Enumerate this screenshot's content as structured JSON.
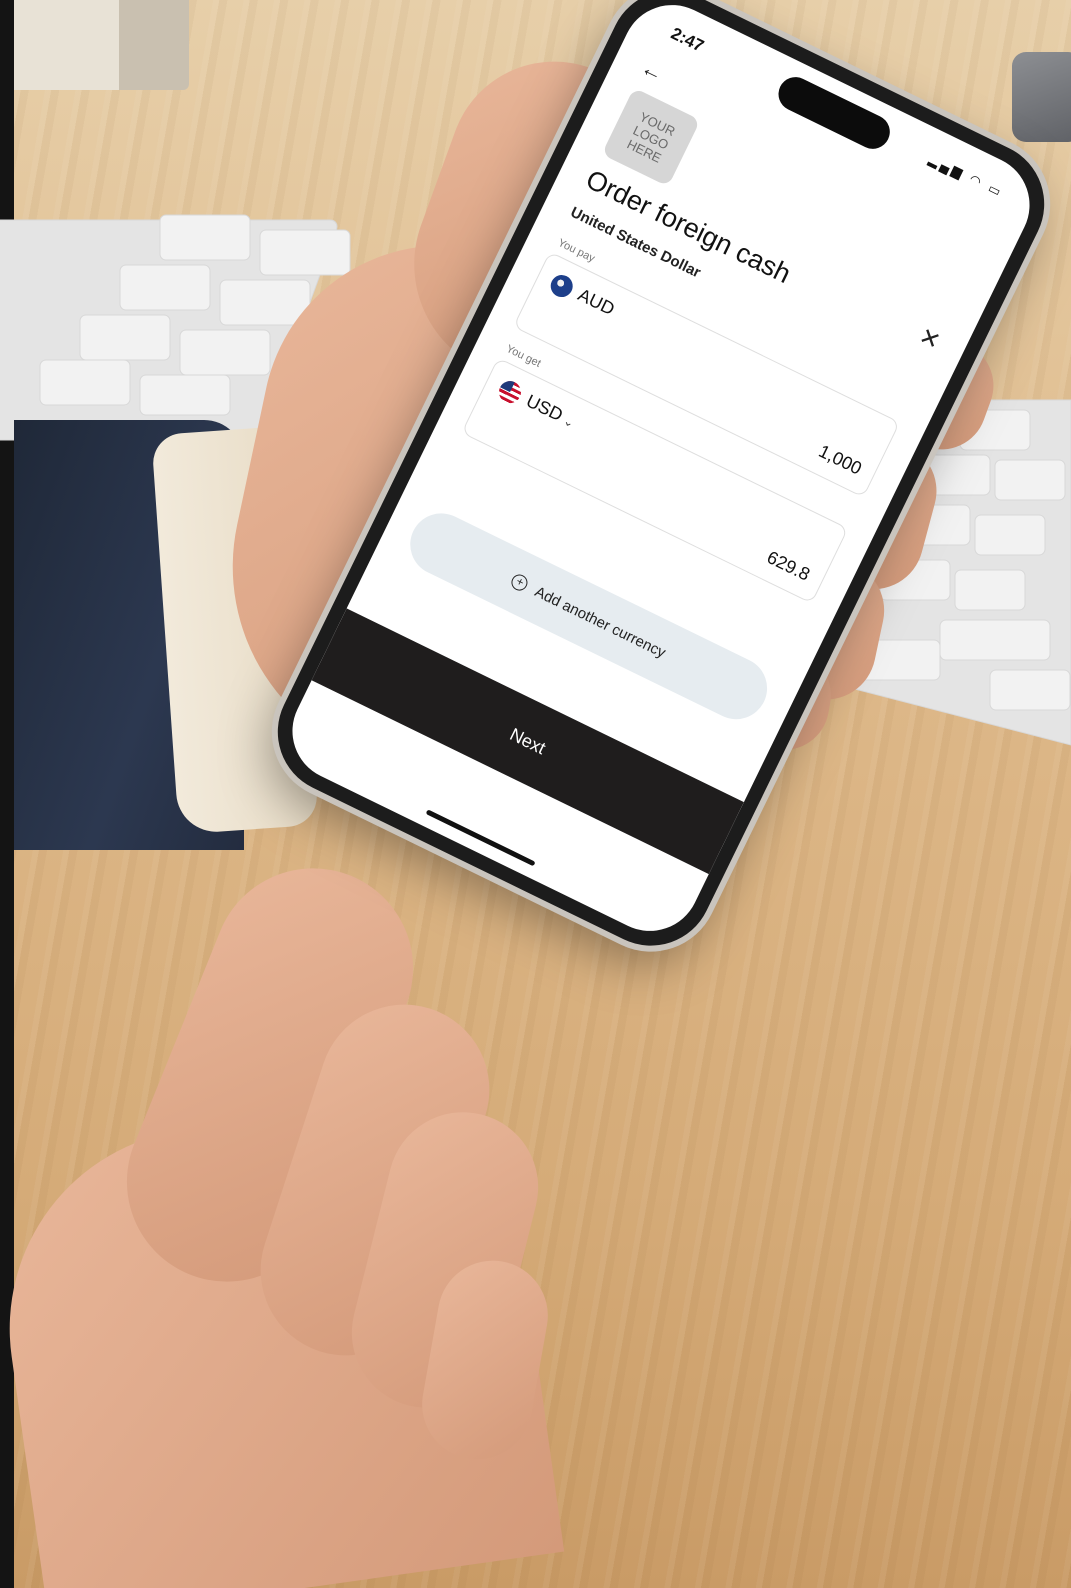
{
  "status_bar": {
    "time": "2:47",
    "icons": "signal wifi battery"
  },
  "logo": {
    "text": "YOUR\nLOGO\nHERE"
  },
  "header": {
    "back_icon": "arrow-left-icon",
    "close_icon": "close-icon"
  },
  "page": {
    "title": "Order foreign cash",
    "subtitle": "United States Dollar"
  },
  "pay": {
    "label": "You pay",
    "currency": "AUD",
    "amount": "1,000",
    "flag": "australia-flag-icon"
  },
  "get": {
    "label": "You get",
    "currency": "USD",
    "amount": "629.8",
    "flag": "usa-flag-icon"
  },
  "actions": {
    "add_currency": "Add another currency",
    "next": "Next"
  },
  "colors": {
    "next_bg": "#1f1d1d",
    "add_bg": "#e6ecf0"
  }
}
